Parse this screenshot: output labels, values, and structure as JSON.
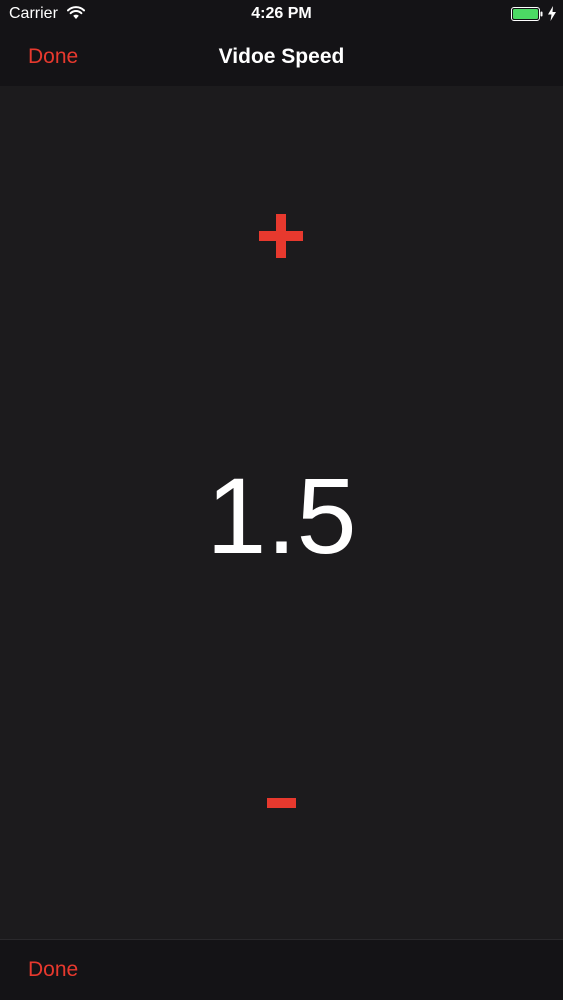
{
  "status_bar": {
    "carrier": "Carrier",
    "time": "4:26 PM",
    "battery_color": "#4cd964"
  },
  "nav_bar": {
    "done_label": "Done",
    "title": "Vidoe Speed"
  },
  "speed": {
    "value": "1.5",
    "increase_icon": "plus-icon",
    "decrease_icon": "minus-icon"
  },
  "toolbar": {
    "done_label": "Done"
  },
  "colors": {
    "accent": "#e7392e",
    "background": "#1c1b1d",
    "bar_background": "#141316",
    "text": "#ffffff"
  }
}
